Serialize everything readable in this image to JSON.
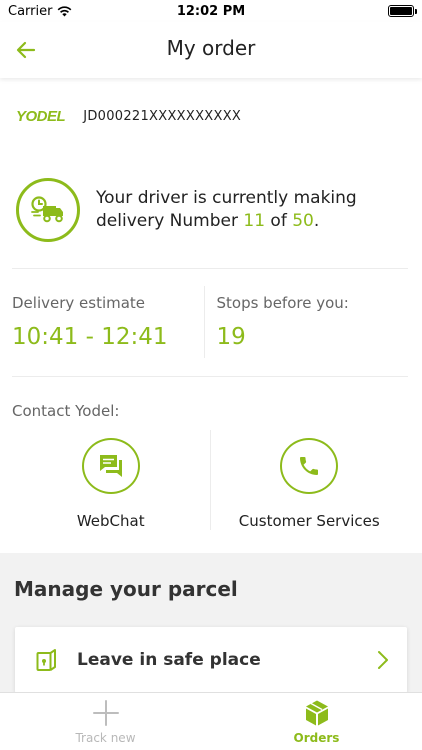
{
  "status_bar": {
    "carrier": "Carrier",
    "time": "12:02 PM"
  },
  "nav": {
    "title": "My order"
  },
  "tracking": {
    "logo": "YODEL",
    "number": "JD000221XXXXXXXXXX"
  },
  "driver": {
    "text_prefix": "Your driver is currently making delivery Number ",
    "current": "11",
    "of_text": " of ",
    "total": "50",
    "suffix": "."
  },
  "estimate": {
    "delivery_label": "Delivery estimate",
    "delivery_value": "10:41 - 12:41",
    "stops_label": "Stops before you:",
    "stops_value": "19"
  },
  "contact": {
    "label": "Contact Yodel:",
    "webchat": "WebChat",
    "customer_services": "Customer Services"
  },
  "manage": {
    "title": "Manage your parcel",
    "actions": [
      {
        "label": "Leave in safe place"
      }
    ]
  },
  "tabs": [
    {
      "label": "Track new",
      "active": false
    },
    {
      "label": "Orders",
      "active": true
    }
  ],
  "colors": {
    "accent": "#8dbb1b",
    "text": "#222222",
    "muted": "#666666",
    "section_bg": "#f2f2f2"
  }
}
